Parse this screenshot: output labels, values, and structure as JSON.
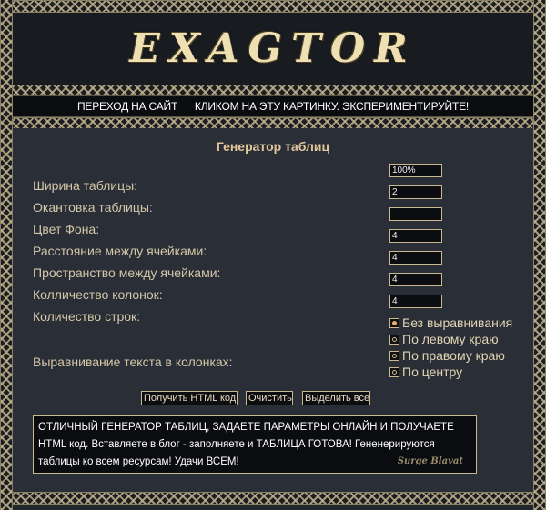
{
  "header": {
    "logo_text": "EXAGTOR"
  },
  "banner": {
    "text": "ПЕРЕХОД НА САЙТ      КЛИКОМ НА ЭТУ КАРТИНКУ. ЭКСПЕРИМЕНТИРУЙТЕ!"
  },
  "form": {
    "title": "Генератор таблиц",
    "labels": {
      "width": "Ширина таблицы:",
      "border": "Окантовка таблицы:",
      "bg_color": "Цвет Фона:",
      "cell_spacing": "Расстояние между ячейками:",
      "cell_padding": "Пространство между ячейками:",
      "columns": "Колличество колонок:",
      "rows": "Количество строк:",
      "align": "Выравнивание текста в колонках:"
    },
    "values": {
      "width": "100%",
      "border": "2",
      "bg_color": "",
      "cell_spacing": "4",
      "cell_padding": "4",
      "columns": "4",
      "rows": "4"
    },
    "align_options": [
      {
        "label": "Без выравнивания",
        "checked": true
      },
      {
        "label": "По левому краю",
        "checked": false
      },
      {
        "label": "По правому краю",
        "checked": false
      },
      {
        "label": "По центру",
        "checked": false
      }
    ],
    "buttons": {
      "get_html": "Получить HTML код",
      "clear": "Очистить",
      "select_all": "Выделить все"
    }
  },
  "info": {
    "line1": "ОТЛИЧНЫЙ ГЕНЕРАТОР ТАБЛИЦ, ЗАДАЕТЕ ПАРАМЕТРЫ ОНЛАЙН И ПОЛУЧАЕТЕ",
    "line2": "HTML код. Вставляете в блог - заполняете и ТАБЛИЦА ГОТОВА! Гененерируются",
    "line3": "таблицы ко всем ресурсам! Удачи ВСЕМ!",
    "signature": "Surge Blavat"
  },
  "colors": {
    "background": "#22262d",
    "accent": "#e2c79a",
    "frame": "#beb08c"
  }
}
